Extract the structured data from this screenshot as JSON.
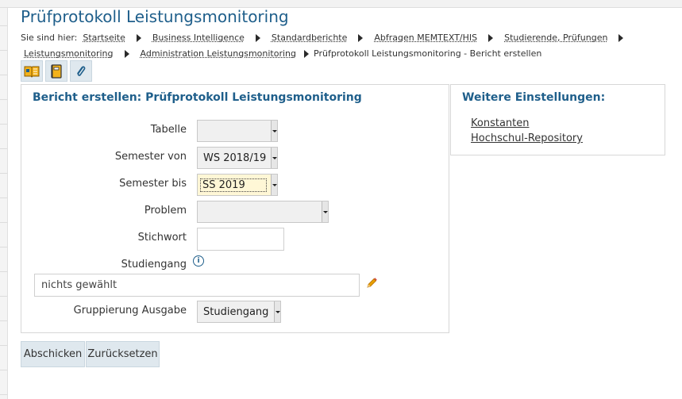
{
  "page": {
    "title": "Prüfprotokoll Leistungsmonitoring"
  },
  "breadcrumb": {
    "lead": "Sie sind hier:",
    "items": [
      "Startseite",
      "Business Intelligence",
      "Standardberichte",
      "Abfragen MEMTEXT/HIS",
      "Studierende, Prüfungen",
      "Leistungsmonitoring",
      "Administration Leistungsmonitoring"
    ],
    "current": "Prüfprotokoll Leistungsmonitoring - Bericht erstellen"
  },
  "toolbar": {
    "icons": [
      "book-info-icon",
      "notebook-icon",
      "paperclip-icon"
    ]
  },
  "form": {
    "heading": "Bericht erstellen: Prüfprotokoll Leistungsmonitoring",
    "tabelle": {
      "label": "Tabelle",
      "value": ""
    },
    "semester_von": {
      "label": "Semester von",
      "value": "WS 2018/19"
    },
    "semester_bis": {
      "label": "Semester bis",
      "value": "SS 2019"
    },
    "problem": {
      "label": "Problem",
      "value": ""
    },
    "stichwort": {
      "label": "Stichwort",
      "value": ""
    },
    "studiengang": {
      "label": "Studiengang",
      "value": "nichts gewählt"
    },
    "gruppierung": {
      "label": "Gruppierung Ausgabe",
      "value": "Studiengang"
    }
  },
  "side": {
    "heading": "Weitere Einstellungen:",
    "links": [
      "Konstanten",
      "Hochschul-Repository"
    ]
  },
  "buttons": {
    "submit": "Abschicken",
    "reset": "Zurücksetzen"
  },
  "colors": {
    "accent": "#1f5f8b",
    "button_bg": "#dfe8ee",
    "highlight_select": "#fff7d6",
    "edit_icon": "#e8a000"
  }
}
